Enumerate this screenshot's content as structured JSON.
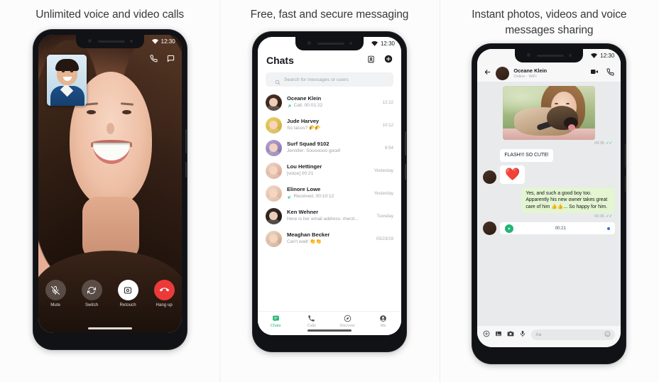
{
  "panels": [
    {
      "caption": "Unlimited voice and video calls",
      "status": {
        "time": "12:30",
        "wifi": "wifi-icon"
      },
      "topIcons": [
        {
          "name": "call-icon"
        },
        {
          "name": "chat-bubble-icon"
        }
      ],
      "controls": [
        {
          "label": "Mute",
          "icon": "mic-off-icon"
        },
        {
          "label": "Switch",
          "icon": "camera-switch-icon"
        },
        {
          "label": "Retouch",
          "icon": "retouch-icon"
        },
        {
          "label": "Hang up",
          "icon": "hangup-icon"
        }
      ]
    },
    {
      "caption": "Free, fast and secure messaging",
      "status": {
        "time": "12:30",
        "wifi": "wifi-icon"
      },
      "title": "Chats",
      "headIcons": [
        {
          "name": "contacts-icon"
        },
        {
          "name": "add-chat-icon"
        }
      ],
      "search": {
        "placeholder": "Search for messages or users",
        "icon": "search-icon"
      },
      "rows": [
        {
          "name": "Oceane Klein",
          "preview": "Call, 00:01:22",
          "time": "12:22",
          "icon": "call-made-icon",
          "avatar": "av-a"
        },
        {
          "name": "Jude Harvey",
          "preview": "So tacos? 🌮🌮",
          "time": "10:12",
          "icon": "",
          "avatar": "av-b"
        },
        {
          "name": "Surf Squad 9102",
          "preview": "Jennifer: Sooooooo good!",
          "time": "8:54",
          "icon": "",
          "avatar": "av-c"
        },
        {
          "name": "Lou Hettinger",
          "preview": "[voice] 00:21",
          "time": "Yesterday",
          "icon": "",
          "avatar": "av-d"
        },
        {
          "name": "Elinore Lowe",
          "preview": "Received, 00:10:12",
          "time": "Yesterday",
          "icon": "call-received-icon",
          "avatar": "av-e"
        },
        {
          "name": "Ken Wehner",
          "preview": "Here is her email address: rherzl...",
          "time": "Tuesday",
          "icon": "",
          "avatar": "av-f"
        },
        {
          "name": "Meaghan Becker",
          "preview": "Can't wait! 👏👏",
          "time": "05/23/19",
          "icon": "",
          "avatar": "av-g"
        }
      ],
      "nav": [
        {
          "label": "Chats",
          "icon": "chats-icon",
          "active": true
        },
        {
          "label": "Calls",
          "icon": "phone-icon",
          "active": false
        },
        {
          "label": "Discover",
          "icon": "compass-icon",
          "active": false
        },
        {
          "label": "Me",
          "icon": "profile-icon",
          "active": false
        }
      ]
    },
    {
      "caption": "Instant photos, videos and voice messages sharing",
      "status": {
        "time": "12:30",
        "wifi": "wifi-icon"
      },
      "contact": {
        "name": "Oceane Klein",
        "status": "Online · WiFi"
      },
      "headIcons": [
        {
          "name": "back-arrow-icon"
        },
        {
          "name": "video-call-icon"
        },
        {
          "name": "voice-call-icon"
        }
      ],
      "messages": [
        {
          "type": "photo",
          "meta": "09:35",
          "tick": "✓✓"
        },
        {
          "type": "in",
          "text": "FLASH!!! SO CUTE!"
        },
        {
          "type": "in-emoji",
          "text": "❤️"
        },
        {
          "type": "out",
          "text": "Yes, and such a good boy too. Apparently his new owner takes great care of him 👍👍... So happy for him.",
          "meta": "00:36",
          "tick": "✓✓"
        },
        {
          "type": "voice",
          "duration": "00:21"
        }
      ],
      "input": {
        "placeholder": "Aa",
        "icons": [
          {
            "name": "plus-icon"
          },
          {
            "name": "gallery-icon"
          },
          {
            "name": "camera-icon"
          },
          {
            "name": "mic-icon"
          }
        ],
        "emoji": {
          "name": "emoji-icon"
        }
      }
    }
  ],
  "colors": {
    "accent_green": "#22b573",
    "bubble_out": "#e4f5d2",
    "hangup_red": "#ec3a3a",
    "bg": "#fcfcfc"
  }
}
